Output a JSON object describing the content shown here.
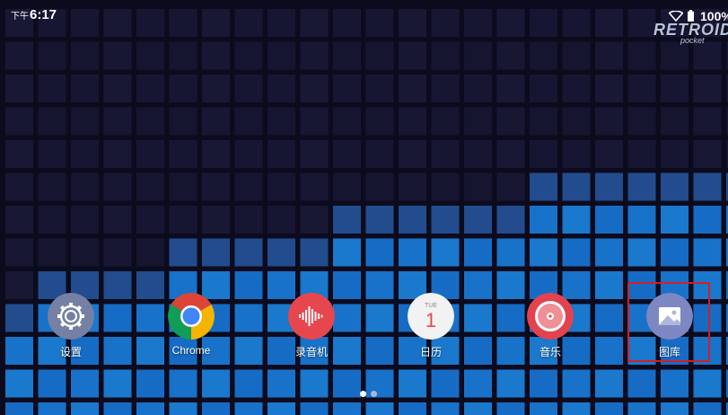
{
  "status_bar": {
    "time_prefix": "下午",
    "time": "6:17",
    "battery_percent": "100%",
    "icons": [
      "wifi-icon",
      "battery-icon"
    ]
  },
  "wallpaper": {
    "watermark_main": "RETROID",
    "watermark_sub": "pocket"
  },
  "dock": {
    "apps": [
      {
        "label": "设置",
        "icon": "settings-gear-icon",
        "color": "#7680a4"
      },
      {
        "label": "Chrome",
        "icon": "chrome-icon",
        "color": "#db4437"
      },
      {
        "label": "录音机",
        "icon": "sound-recorder-icon",
        "color": "#e6474e"
      },
      {
        "label": "日历",
        "icon": "calendar-icon",
        "color": "#f2f2f2",
        "day": "TUE",
        "date": "1"
      },
      {
        "label": "音乐",
        "icon": "music-disc-icon",
        "color": "#e2434f"
      },
      {
        "label": "图库",
        "icon": "gallery-icon",
        "color": "#7d87c2",
        "highlighted": true
      }
    ]
  },
  "page_indicator": {
    "current": 1,
    "total": 2
  }
}
